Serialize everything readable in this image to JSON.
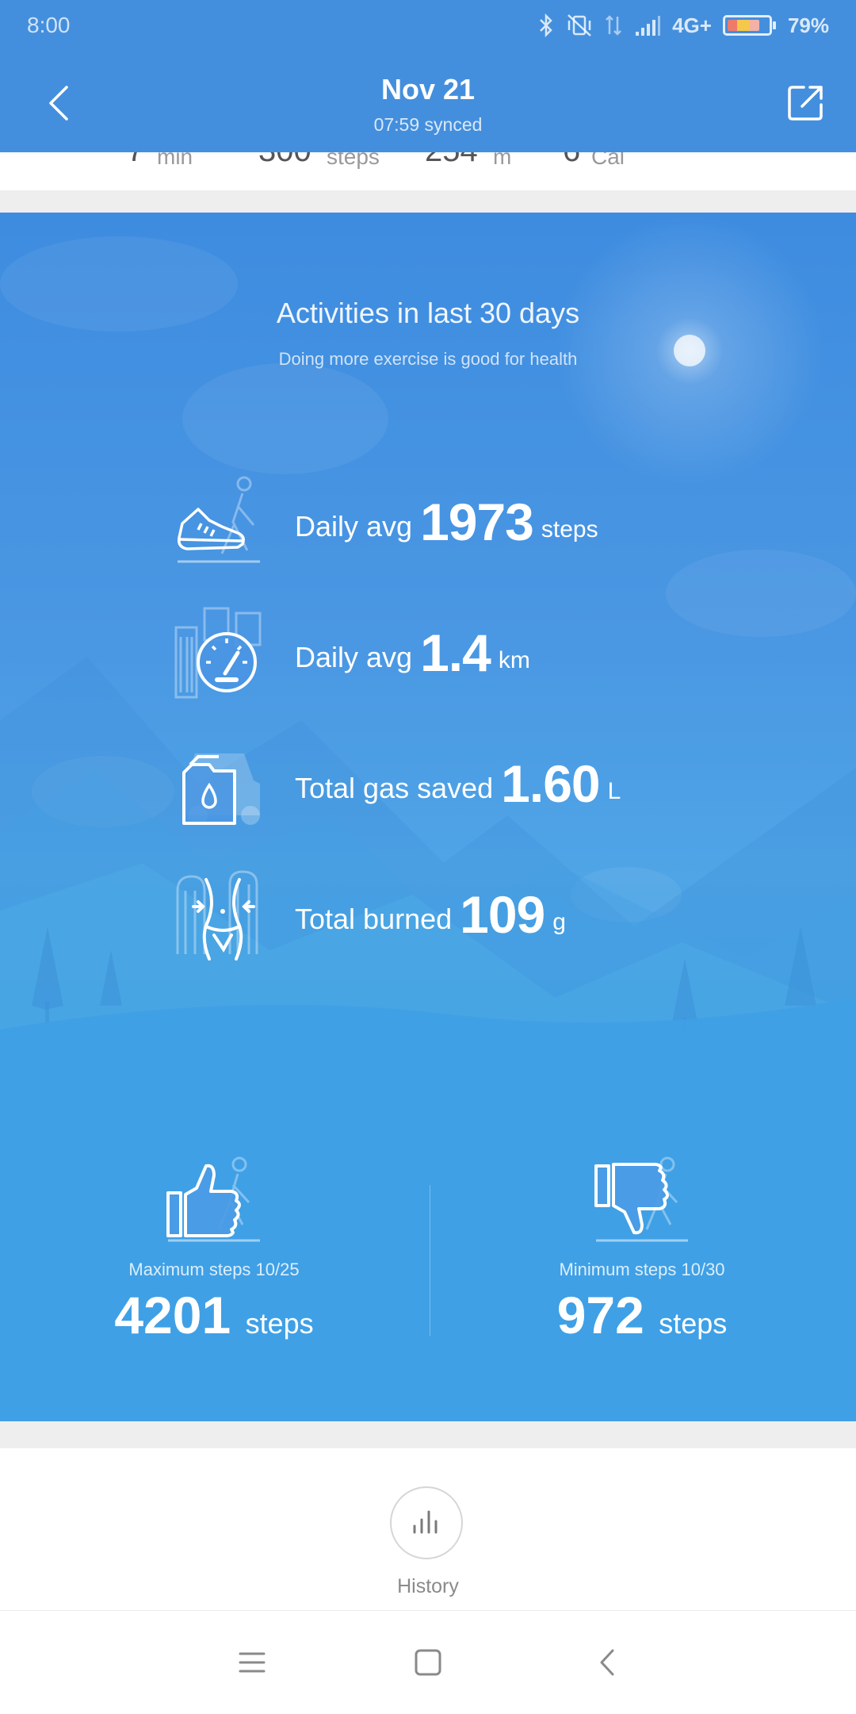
{
  "status_bar": {
    "time": "8:00",
    "network": "4G+",
    "battery": "79%",
    "icons": [
      "bluetooth-icon",
      "vibrate-off-icon",
      "data-arrows-icon",
      "signal-icon",
      "battery-icon"
    ]
  },
  "header": {
    "title": "Nov 21",
    "subtitle": "07:59 synced",
    "back_icon": "chevron-left-icon",
    "share_icon": "share-out-icon"
  },
  "colors": {
    "header_bg": "#448FDD",
    "card_top": "#3E8CE0",
    "card_bottom": "#3DA0E5"
  },
  "card": {
    "title": "Activities in last 30 days",
    "subtitle": "Doing more exercise is good for health",
    "rows": [
      {
        "label": "Daily avg",
        "value": "1973",
        "unit": "steps",
        "icon": "walking-shoe-icon"
      },
      {
        "label": "Daily avg",
        "value": "1.4",
        "unit": "km",
        "icon": "speedometer-city-icon"
      },
      {
        "label": "Total gas saved",
        "value": "1.60",
        "unit": "L",
        "icon": "gas-can-icon"
      },
      {
        "label": "Total burned",
        "value": "109",
        "unit": "g",
        "icon": "waist-fat-burn-icon"
      }
    ],
    "max": {
      "label": "Maximum steps 10/25",
      "value": "4201",
      "unit": "steps",
      "icon": "thumbs-up-icon"
    },
    "min": {
      "label": "Minimum steps 10/30",
      "value": "972",
      "unit": "steps",
      "icon": "thumbs-down-icon"
    }
  },
  "history": {
    "label": "History",
    "icon": "bar-chart-icon"
  },
  "navbar": {
    "icons": [
      "menu-icon",
      "home-square-icon",
      "back-triangle-icon"
    ]
  }
}
